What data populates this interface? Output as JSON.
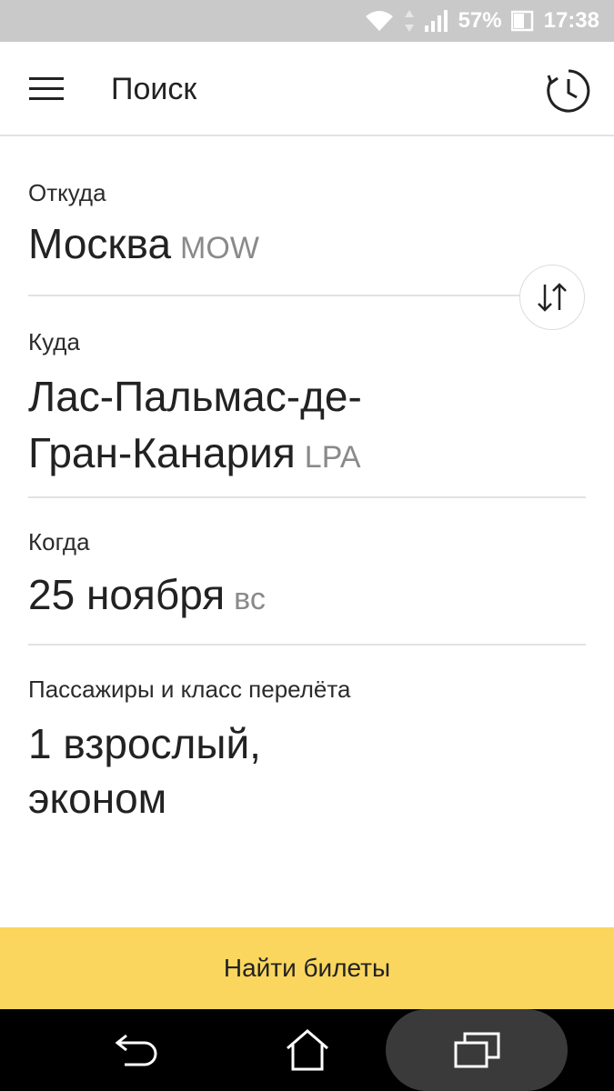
{
  "status_bar": {
    "battery_percent": "57%",
    "time": "17:38"
  },
  "app_bar": {
    "title": "Поиск",
    "menu_icon": "hamburger-menu-icon",
    "history_icon": "history-clock-icon"
  },
  "form": {
    "from": {
      "label": "Откуда",
      "city": "Москва",
      "code": "MOW"
    },
    "to": {
      "label": "Куда",
      "city_line1": "Лас-Пальмас-де-",
      "city_line2": "Гран-Канария",
      "code": "LPA"
    },
    "when": {
      "label": "Когда",
      "date": "25 ноября",
      "weekday": "вс"
    },
    "passengers": {
      "label": "Пассажиры и класс перелёта",
      "line1": "1 взрослый,",
      "line2": "эконом"
    },
    "swap_icon": "swap-arrows-icon"
  },
  "find_button": {
    "label": "Найти билеты",
    "color": "#fad65e"
  },
  "nav_bar": {
    "back_icon": "back-icon",
    "home_icon": "home-icon",
    "recents_icon": "recents-icon"
  }
}
